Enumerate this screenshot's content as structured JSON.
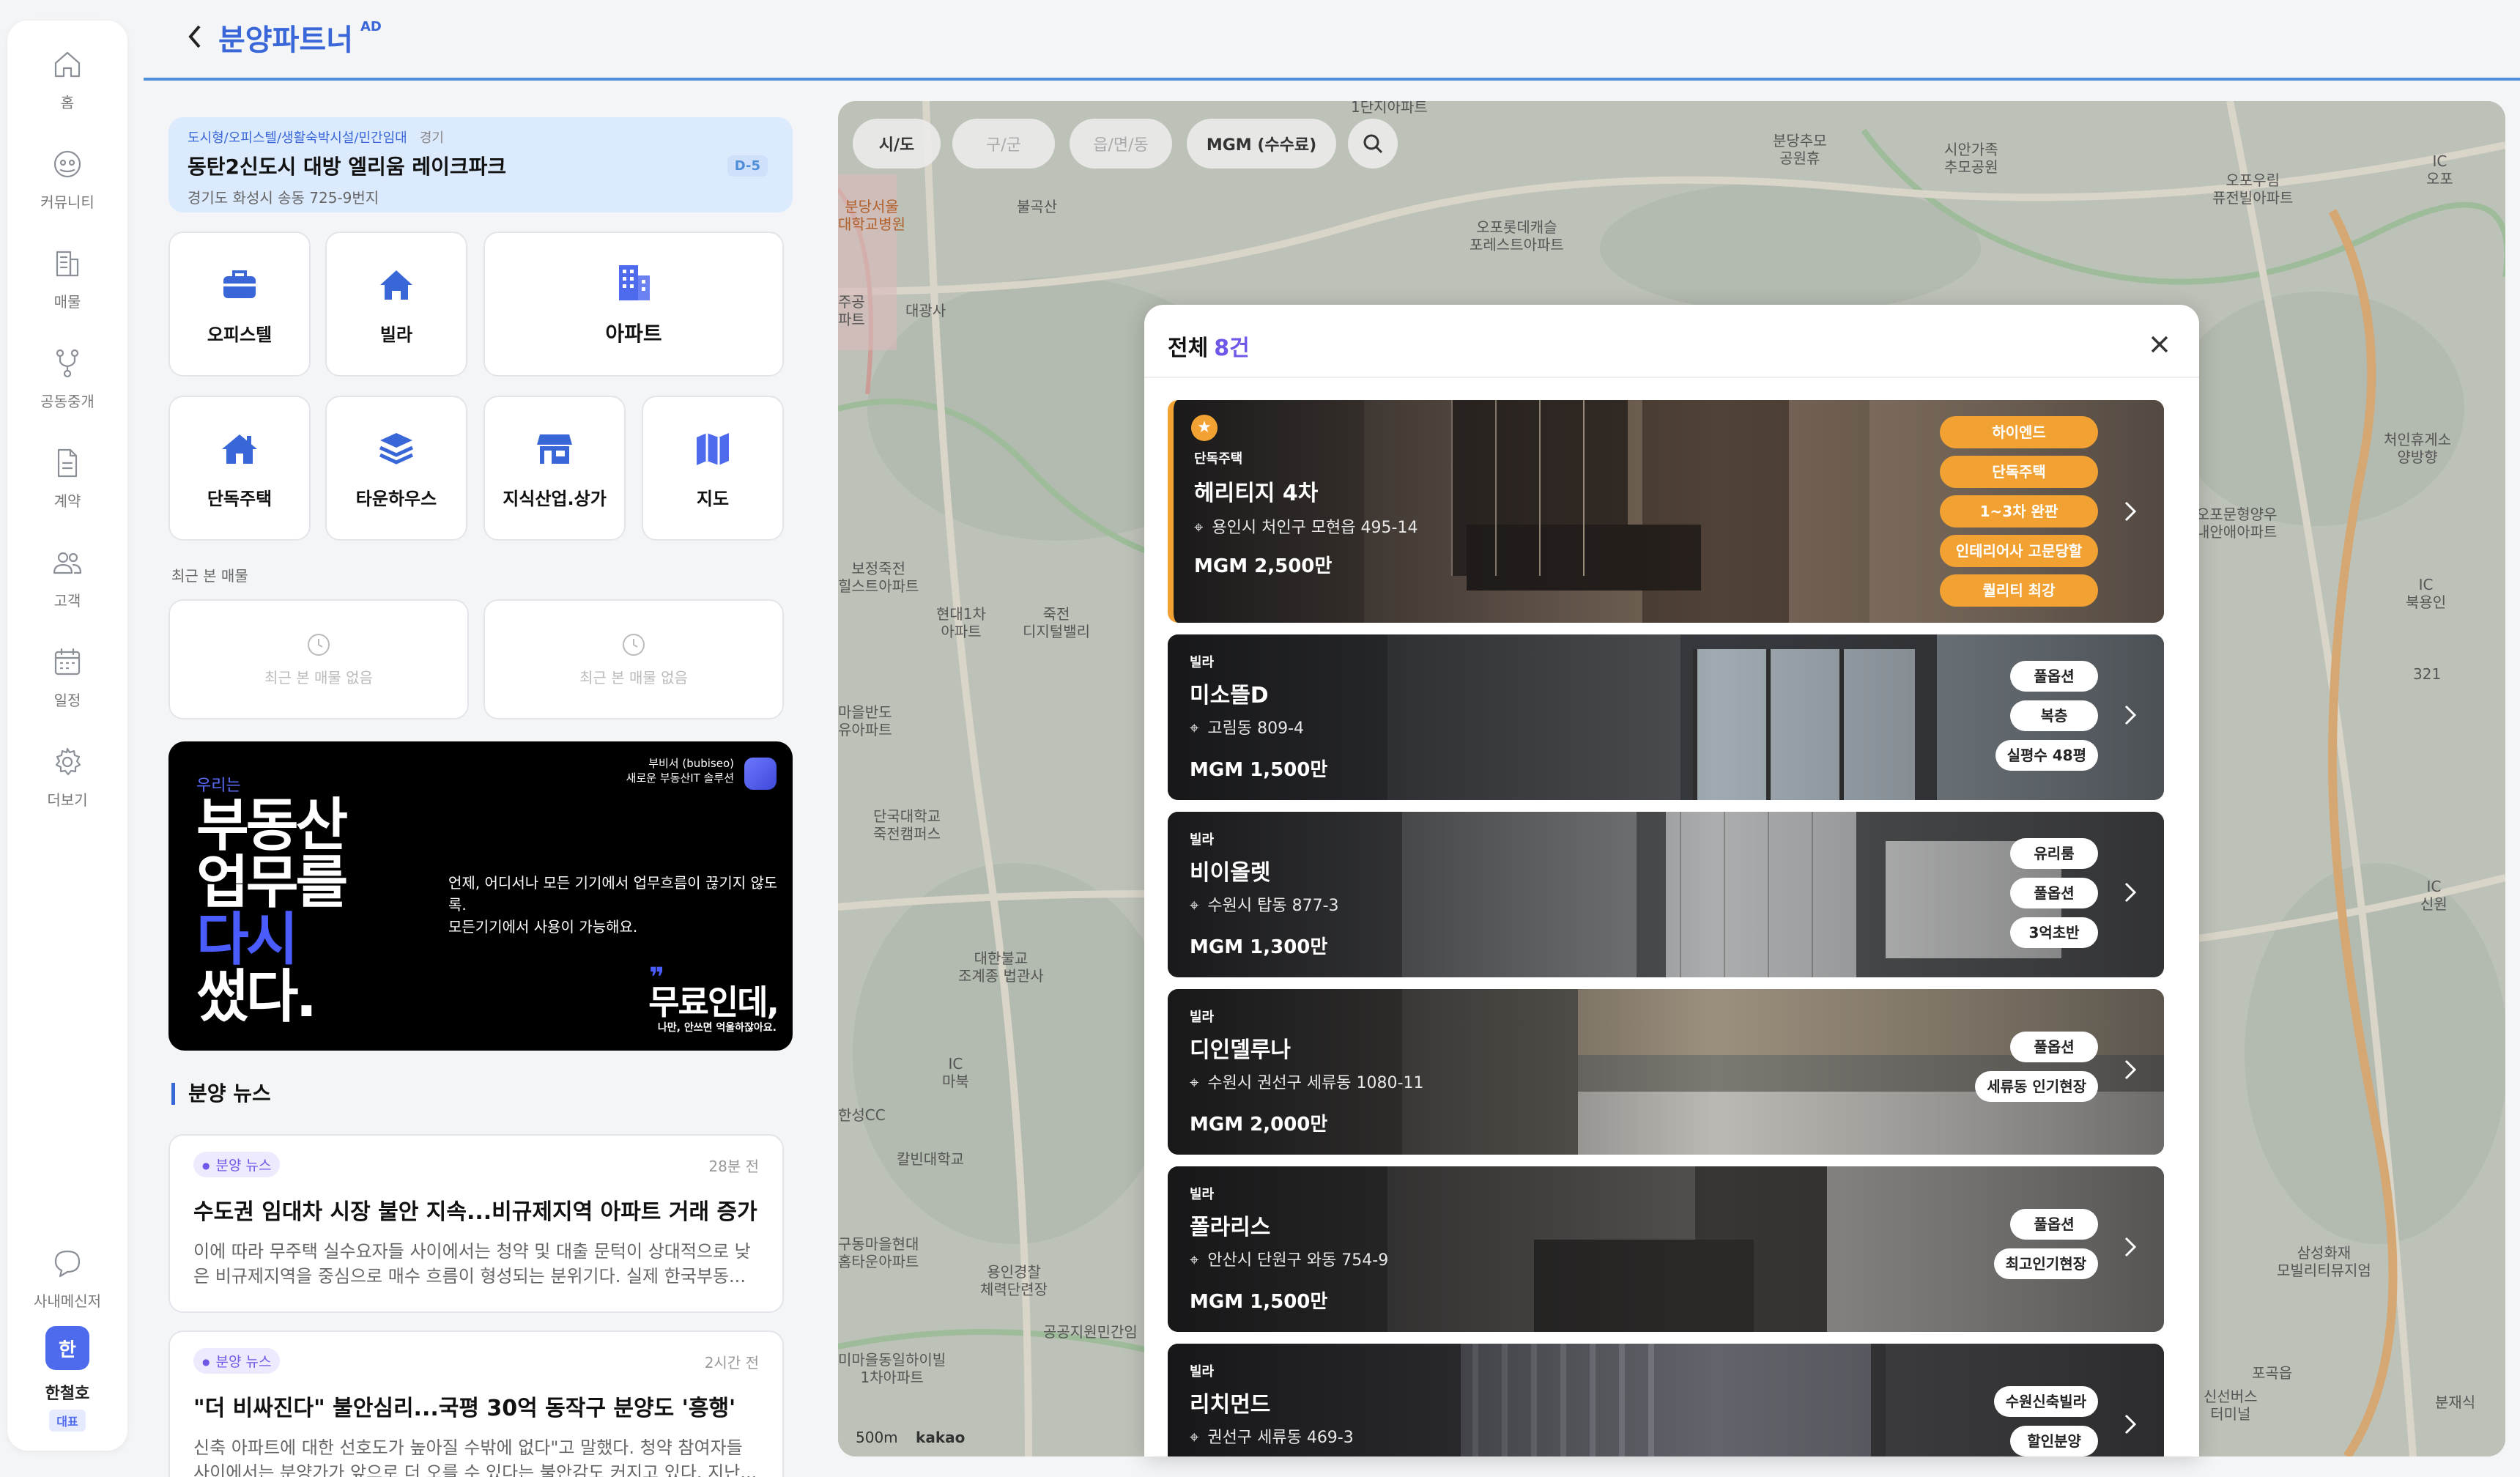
{
  "sidebar": {
    "items": [
      {
        "label": "홈",
        "icon": "home-icon"
      },
      {
        "label": "커뮤니티",
        "icon": "community-icon"
      },
      {
        "label": "매물",
        "icon": "building-icon"
      },
      {
        "label": "공동중개",
        "icon": "share-icon"
      },
      {
        "label": "계약",
        "icon": "document-icon"
      },
      {
        "label": "고객",
        "icon": "users-icon"
      },
      {
        "label": "일정",
        "icon": "calendar-icon"
      },
      {
        "label": "더보기",
        "icon": "gear-icon"
      }
    ],
    "messenger": "사내메신저",
    "profile": {
      "initial": "한",
      "name": "한철호",
      "role": "대표"
    }
  },
  "header": {
    "title": "분양파트너",
    "badge": "AD"
  },
  "promo": {
    "category": "도시형/오피스텔/생활숙박시설/민간임대",
    "region": "경기",
    "title": "동탄2신도시 대방 엘리움 레이크파크",
    "address": "경기도 화성시 송동 725-9번지",
    "dday": "D-5"
  },
  "tiles": {
    "officetel": "오피스텔",
    "villa": "빌라",
    "apartment": "아파트",
    "house": "단독주택",
    "townhouse": "타운하우스",
    "commercial": "지식산업.상가",
    "map": "지도"
  },
  "recent": {
    "title": "최근 본 매물",
    "empty": "최근 본 매물 없음"
  },
  "banner": {
    "small": "우리는",
    "line1": "부동산",
    "line2": "업무를",
    "line3": "다시",
    "line4": "썼다.",
    "brand1": "부비서 (bubiseo)",
    "brand2": "새로운 부동산IT 솔루션",
    "desc1": "언제, 어디서나 모든 기기에서 업무흐름이 끊기지 않도록.",
    "desc2": "모든기기에서 사용이 가능해요.",
    "free": "무료인데,",
    "free_sub": "나만, 안쓰면 억울하잖아요."
  },
  "news": {
    "section_title": "분양 뉴스",
    "items": [
      {
        "badge": "분양 뉴스",
        "time": "28분 전",
        "title": "수도권 임대차 시장 불안 지속...비규제지역 아파트 거래 증가",
        "body1": "이에 따라 무주택 실수요자들 사이에서는 청약 및 대출 문턱이 상대적으로 낮",
        "body2": "은 비규제지역을 중심으로 매수 흐름이 형성되는 분위기다. 실제 한국부동..."
      },
      {
        "badge": "분양 뉴스",
        "time": "2시간 전",
        "title": "\"더 비싸진다\" 불안심리...국평 30억 동작구 분양도 '흥행'",
        "body1": "신축 아파트에 대한 선호도가 높아질 수밖에 없다\"고 말했다. 청약 참여자들",
        "body2": "사이에서는 분양가가 앞으로 더 오를 수 있다는 불안감도 커지고 있다. 지난..."
      }
    ]
  },
  "map": {
    "filters": {
      "sido": "시/도",
      "sigungu": "구/군",
      "dong": "읍/면/동",
      "mgm": "MGM (수수료)"
    },
    "labels": [
      {
        "text": "1단지아파트"
      },
      {
        "text": "분당추모\n공원휴"
      },
      {
        "text": "시안가족\n추모공원"
      },
      {
        "text": "오포우림\n퓨전빌아파트"
      },
      {
        "text": "IC\n오포"
      },
      {
        "text": "분당서울\n대학교병원"
      },
      {
        "text": "불곡산"
      },
      {
        "text": "오포롯데캐슬\n포레스트아파트"
      },
      {
        "text": "주공\n파트"
      },
      {
        "text": "대광사"
      },
      {
        "text": "처인휴게소\n양방향"
      },
      {
        "text": "오포문형양우\n내안애아파트"
      },
      {
        "text": "IC\n북용인"
      },
      {
        "text": "321"
      },
      {
        "text": "보정죽전\n힐스트아파트"
      },
      {
        "text": "현대1차\n아파트"
      },
      {
        "text": "죽전\n디지털밸리"
      },
      {
        "text": "마을반도\n유아파트"
      },
      {
        "text": "단국대학교\n죽전캠퍼스"
      },
      {
        "text": "IC\n신원"
      },
      {
        "text": "대한불교\n조계종 법관사"
      },
      {
        "text": "IC\n마북"
      },
      {
        "text": "한성CC"
      },
      {
        "text": "칼빈대학교"
      },
      {
        "text": "구동마을현대\n홈타운아파트"
      },
      {
        "text": "용인경찰\n체력단련장"
      },
      {
        "text": "공공지원민간임"
      },
      {
        "text": "삼성화재\n모빌리티뮤지엄"
      },
      {
        "text": "미마을동일하이빌\n1차아파트"
      },
      {
        "text": "포곡읍"
      },
      {
        "text": "신선버스\n터미널"
      },
      {
        "text": "분재식"
      }
    ],
    "scale": "500m",
    "provider": "kakao"
  },
  "modal": {
    "title": "전체",
    "count": "8건",
    "listings": [
      {
        "type": "단독주택",
        "name": "헤리티지 4차",
        "address": "용인시 처인구 모현읍 495-14",
        "mgm": "MGM 2,500만",
        "tags": [
          "하이엔드",
          "단독주택",
          "1~3차 완판",
          "인테리어사 고문당할",
          "퀄리티 최강"
        ],
        "featured": true
      },
      {
        "type": "빌라",
        "name": "미소뜰D",
        "address": "고림동 809-4",
        "mgm": "MGM 1,500만",
        "tags": [
          "풀옵션",
          "복층",
          "실평수 48평"
        ]
      },
      {
        "type": "빌라",
        "name": "비이올렛",
        "address": "수원시 탑동 877-3",
        "mgm": "MGM 1,300만",
        "tags": [
          "유리룸",
          "풀옵션",
          "3억초반"
        ]
      },
      {
        "type": "빌라",
        "name": "디인델루나",
        "address": "수원시 권선구 세류동 1080-11",
        "mgm": "MGM 2,000만",
        "tags": [
          "풀옵션",
          "세류동 인기현장"
        ]
      },
      {
        "type": "빌라",
        "name": "폴라리스",
        "address": "안산시 단원구 와동 754-9",
        "mgm": "MGM 1,500만",
        "tags": [
          "풀옵션",
          "최고인기현장"
        ]
      },
      {
        "type": "빌라",
        "name": "리치먼드",
        "address": "권선구 세류동 469-3",
        "mgm": "",
        "tags": [
          "수원신축빌라",
          "할인분양"
        ]
      }
    ]
  },
  "colors": {
    "accent": "#3a67d8",
    "featured": "#f2a233",
    "count": "#6f58e8"
  }
}
